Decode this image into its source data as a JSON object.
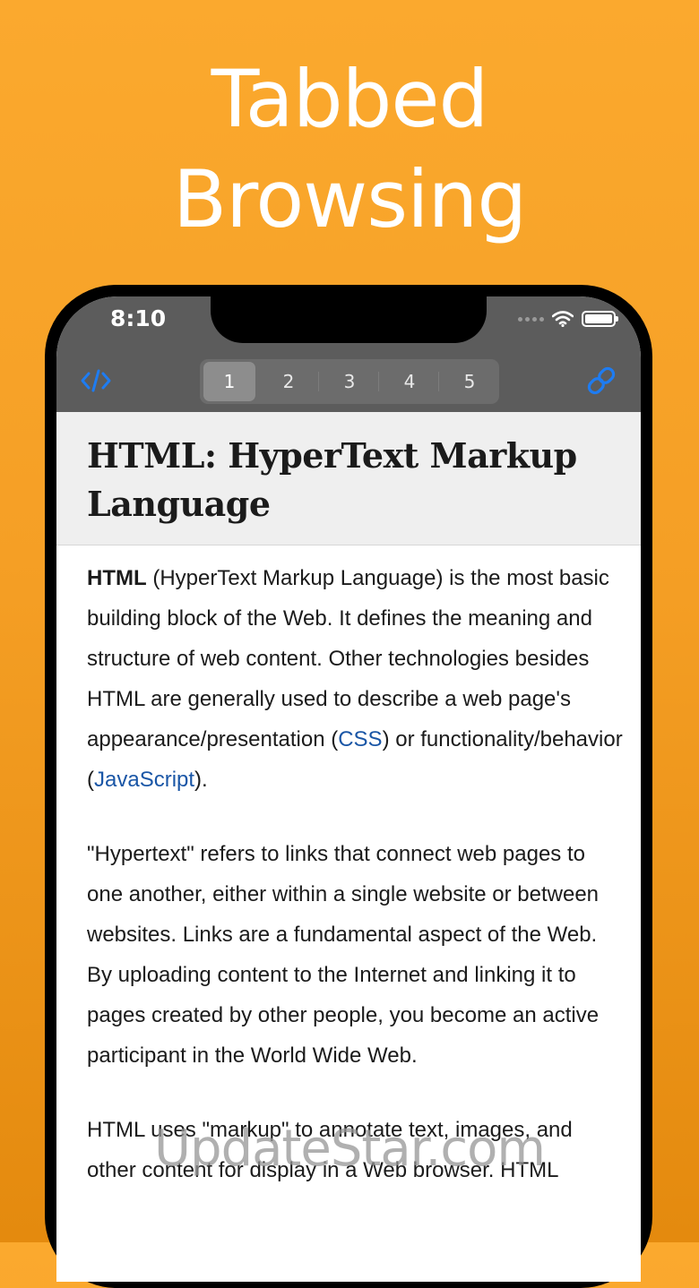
{
  "promo": {
    "line1": "Tabbed",
    "line2": "Browsing"
  },
  "status_bar": {
    "time": "8:10"
  },
  "toolbar": {
    "tabs": [
      "1",
      "2",
      "3",
      "4",
      "5"
    ],
    "active_tab": "1",
    "accent_color": "#1E7CF2"
  },
  "article": {
    "title_line1": "HTML: HyperText Markup",
    "title_line2": "Language",
    "p1": {
      "bold": "HTML",
      "text_a": " (HyperText Markup Language) is the most basic building block of the Web. It defines the meaning and structure of web content. Other technologies besides HTML are generally used to describe a web page's appearance/presentation (",
      "link_css": "CSS",
      "text_b": ") or functionality/behavior (",
      "link_js": "JavaScript",
      "text_c": ")."
    },
    "p2": "\"Hypertext\" refers to links that connect web pages to one another, either within a single website or between websites. Links are a fundamental aspect of the Web. By uploading content to the Internet and linking it to pages created by other people, you become an active participant in the World Wide Web.",
    "p3": "HTML uses \"markup\" to annotate text, images, and other content for display in a Web browser. HTML"
  },
  "watermark": "UpdateStar.com"
}
